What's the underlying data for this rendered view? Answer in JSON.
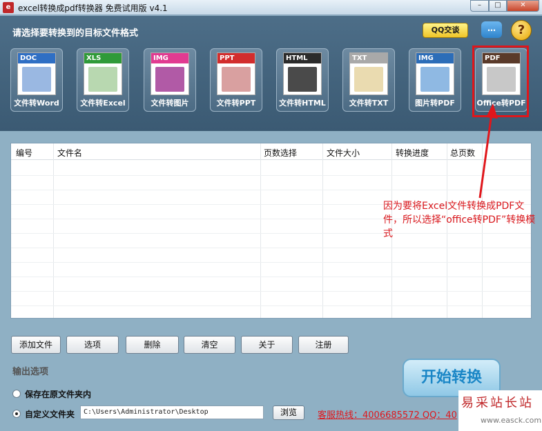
{
  "window": {
    "title": "excel转换成pdf转换器 免费试用版 v4.1",
    "controls": [
      "–",
      "□",
      "✕"
    ]
  },
  "header": {
    "label": "请选择要转换到的目标文件格式",
    "qq_label": "QQ交谈",
    "chat_glyph": "…",
    "help_glyph": "?"
  },
  "formats": [
    {
      "tag": "DOC",
      "label": "文件转Word",
      "color": "#2f6fc4",
      "art": "#9ab8e2"
    },
    {
      "tag": "XLS",
      "label": "文件转Excel",
      "color": "#2f9a39",
      "art": "#b8d8b0"
    },
    {
      "tag": "IMG",
      "label": "文件转图片",
      "color": "#e13b91",
      "art": "#b15aa6"
    },
    {
      "tag": "PPT",
      "label": "文件转PPT",
      "color": "#d22d2d",
      "art": "#d9a0a0"
    },
    {
      "tag": "HTML",
      "label": "文件转HTML",
      "color": "#2b2b2b",
      "art": "#4a4a4a"
    },
    {
      "tag": "TXT",
      "label": "文件转TXT",
      "color": "#a9a9a9",
      "art": "#eadbb0"
    },
    {
      "tag": "IMG",
      "label": "图片转PDF",
      "color": "#2c6db8",
      "art": "#8fb9e3"
    },
    {
      "tag": "PDF",
      "label": "Office转PDF",
      "color": "#5a3a2a",
      "art": "#c8c8c8"
    }
  ],
  "table": {
    "headers": [
      "编号",
      "文件名",
      "页数选择",
      "文件大小",
      "转换进度",
      "总页数"
    ]
  },
  "annotation": "因为要将Excel文件转换成PDF文件，所以选择“office转PDF”转换模式",
  "buttons": [
    "添加文件",
    "选项",
    "删除",
    "清空",
    "关于",
    "注册"
  ],
  "output": {
    "section_label": "输出选项",
    "option_original": "保存在原文件夹内",
    "option_custom": "自定义文件夹",
    "path": "C:\\Users\\Administrator\\Desktop",
    "browse": "浏览",
    "selected": "custom"
  },
  "hotline": "客服热线：4006685572 QQ：40",
  "start_button": "开始转换",
  "watermark": {
    "text": "易采站长站",
    "url": "www.easck.com"
  }
}
